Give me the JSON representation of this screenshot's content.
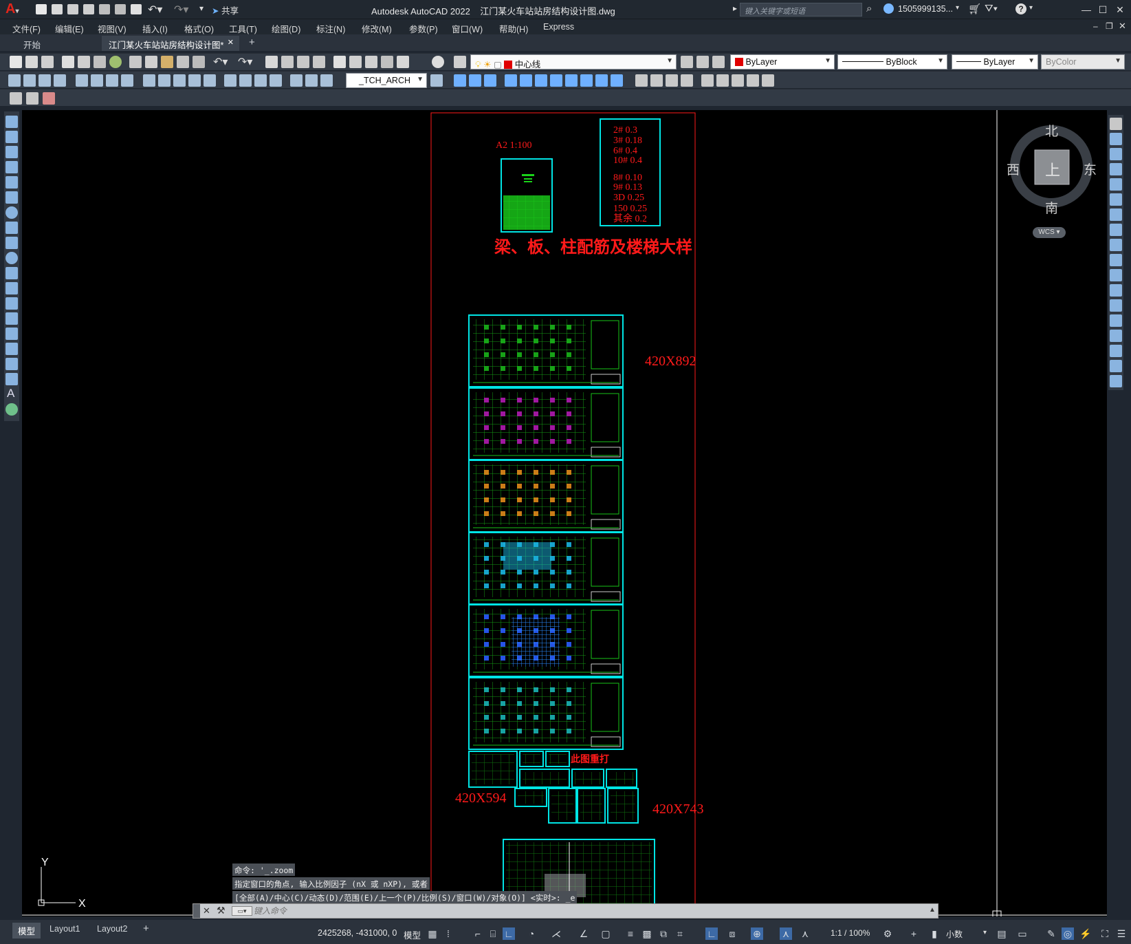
{
  "titlebar": {
    "app_title": "Autodesk AutoCAD 2022    江门某火车站站房结构设计图.dwg",
    "share_label": "共享",
    "search_placeholder": "键入关键字或短语",
    "user_name": "1505999135...",
    "nav_arrow": "▸"
  },
  "menu": {
    "items": [
      "文件(F)",
      "编辑(E)",
      "视图(V)",
      "插入(I)",
      "格式(O)",
      "工具(T)",
      "绘图(D)",
      "标注(N)",
      "修改(M)",
      "参数(P)",
      "窗口(W)",
      "帮助(H)",
      "Express"
    ]
  },
  "tabs": {
    "start": "开始",
    "active_doc": "江门某火车站站房结构设计图*",
    "close_glyph": "✕",
    "add_glyph": "+"
  },
  "toolbar": {
    "layer_name": "中心线",
    "color": "ByLayer",
    "linetype": "ByBlock",
    "lineweight": "ByLayer",
    "plotstyle": "ByColor",
    "dimstyle": "_TCH_ARCH",
    "layer_color": "#e00000"
  },
  "drawing": {
    "scale_note": "A2  1:100",
    "title_cn": "梁、板、柱配筋及楼梯大样",
    "rebar_notes": [
      "2# 0.3",
      "3# 0.18",
      "6# 0.4",
      "10# 0.4",
      "8# 0.10",
      "9# 0.13",
      "3D 0.25",
      "150 0.25",
      "其余 0.2"
    ],
    "size_label_1": "420X892",
    "size_label_2": "420X594",
    "size_label_3": "420X743",
    "reprint_label": "此图重打",
    "accent_red": "#ff1a1a",
    "frame_cyan": "#00e5e5",
    "ucs_y": "Y",
    "ucs_x": "X"
  },
  "viewcube": {
    "north": "北",
    "south": "南",
    "east": "东",
    "west": "西",
    "face": "上",
    "wcs": "WCS"
  },
  "command": {
    "history": [
      "命令: '_.zoom",
      "指定窗口的角点, 输入比例因子 (nX 或 nXP), 或者",
      "[全部(A)/中心(C)/动态(D)/范围(E)/上一个(P)/比例(S)/窗口(W)/对象(O)] <实时>: _e"
    ],
    "input_placeholder": "键入命令"
  },
  "status": {
    "layout_tabs": [
      "模型",
      "Layout1",
      "Layout2"
    ],
    "add_layout": "+",
    "coords": "2425268, -431000, 0",
    "model_label": "模型",
    "scale": "1:1 / 100%",
    "units": "小数"
  }
}
